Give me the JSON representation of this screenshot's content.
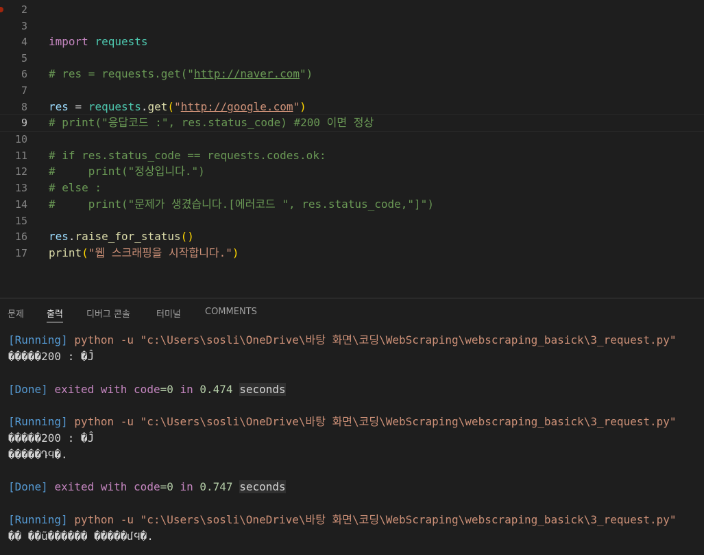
{
  "editor": {
    "lines": [
      {
        "n": "2"
      },
      {
        "n": "3"
      },
      {
        "n": "4"
      },
      {
        "n": "5"
      },
      {
        "n": "6"
      },
      {
        "n": "7"
      },
      {
        "n": "8"
      },
      {
        "n": "9"
      },
      {
        "n": "10"
      },
      {
        "n": "11"
      },
      {
        "n": "12"
      },
      {
        "n": "13"
      },
      {
        "n": "14"
      },
      {
        "n": "15"
      },
      {
        "n": "16"
      },
      {
        "n": "17"
      }
    ],
    "code": {
      "l4_kw": "import",
      "l4_mod": "requests",
      "l6_a": "# res = requests.get(\"",
      "l6_url": "http://naver.com",
      "l6_b": "\")",
      "l8_var": "res",
      "l8_eq": " = ",
      "l8_mod": "requests",
      "l8_dot": ".",
      "l8_fn": "get",
      "l8_po": "(",
      "l8_q1": "\"",
      "l8_url": "http://google.com",
      "l8_q2": "\"",
      "l8_pc": ")",
      "l9": "# print(\"응답코드 :\", res.status_code) #200 이면 정상",
      "l11": "# if res.status_code == requests.codes.ok:",
      "l12": "#     print(\"정상입니다.\")",
      "l13": "# else :",
      "l14": "#     print(\"문제가 생겼습니다.[에러코드 \", res.status_code,\"]\")",
      "l16_var": "res",
      "l16_dot": ".",
      "l16_fn": "raise_for_status",
      "l16_p": "()",
      "l17_fn": "print",
      "l17_po": "(",
      "l17_str": "\"웹 스크래핑을 시작합니다.\"",
      "l17_pc": ")"
    }
  },
  "panel": {
    "tabs": [
      "문제",
      "출력",
      "디버그 콘솔",
      "터미널",
      "COMMENTS"
    ],
    "active_tab": "출력",
    "output": {
      "running_tag": "[Running]",
      "command": "python -u \"c:\\Users\\sosli\\OneDrive\\바탕 화면\\코딩\\WebScraping\\webscraping_basick\\3_request.py\"",
      "garbled1": "�����200 : �Ĵ",
      "garbled2": "�����200 : �Ĵ",
      "garbled3": "�����ԴϤ�.",
      "garbled4": "�� ��ũ������ �����մϤ�.",
      "done_tag": "[Done]",
      "exited_with": "exited with",
      "code_var": "code",
      "code_val": "=0",
      "in_word": "in",
      "time1": "0.474",
      "time2": "0.747",
      "seconds": "seconds"
    }
  },
  "colors": {
    "background": "#1e1e1e",
    "comment": "#6a9955",
    "keyword": "#c586c0",
    "string": "#ce9178",
    "function": "#dcdcaa",
    "variable": "#9cdcfe",
    "module": "#4ec9b0",
    "info_blue": "#569cd6"
  }
}
